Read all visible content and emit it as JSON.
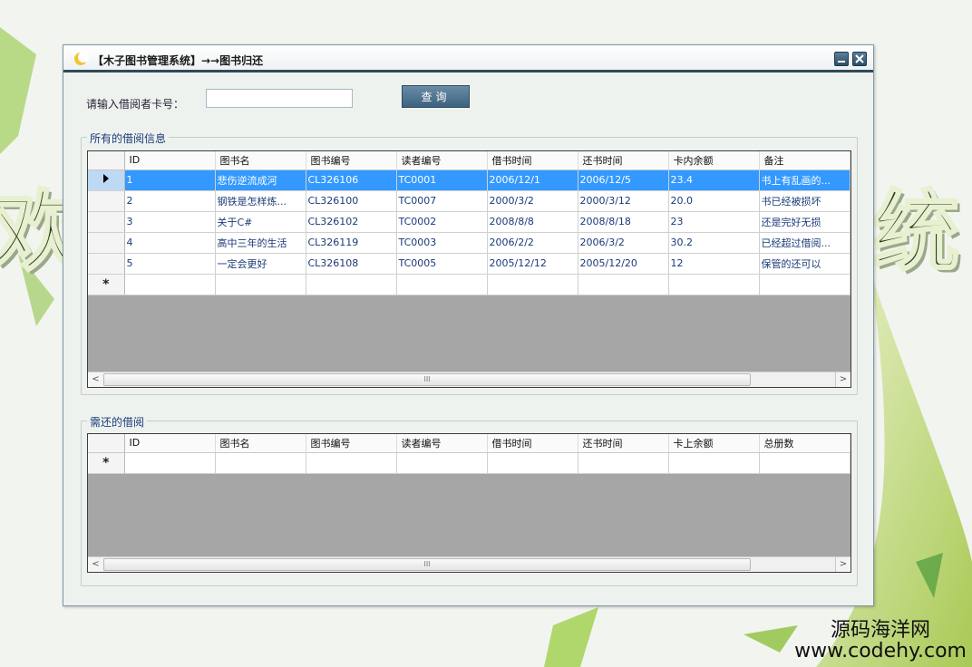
{
  "window": {
    "title": "【木子图书管理系统】→→图书归还"
  },
  "search": {
    "label": "请输入借阅者卡号：",
    "value": "",
    "button_label": "查询"
  },
  "borrow_group": {
    "title": "所有的借阅信息",
    "columns": [
      "ID",
      "图书名",
      "图书编号",
      "读者编号",
      "借书时间",
      "还书时间",
      "卡内余额",
      "备注"
    ],
    "rows": [
      [
        "1",
        "悲伤逆流成河",
        "CL326106",
        "TC0001",
        "2006/12/1",
        "2006/12/5",
        "23.4",
        "书上有乱画的..."
      ],
      [
        "2",
        "钢铁是怎样炼...",
        "CL326100",
        "TC0007",
        "2000/3/2",
        "2000/3/12",
        "20.0",
        "书已经被损坏"
      ],
      [
        "3",
        "关于C#",
        "CL326102",
        "TC0002",
        "2008/8/8",
        "2008/8/18",
        "23",
        "还是完好无损"
      ],
      [
        "4",
        "高中三年的生活",
        "CL326119",
        "TC0003",
        "2006/2/2",
        "2006/3/2",
        "30.2",
        "已经超过借阅..."
      ],
      [
        "5",
        "一定会更好",
        "CL326108",
        "TC0005",
        "2005/12/12",
        "2005/12/20",
        "12",
        "保管的还可以"
      ]
    ]
  },
  "return_group": {
    "title": "需还的借阅",
    "columns": [
      "ID",
      "图书名",
      "图书编号",
      "读者编号",
      "借书时间",
      "还书时间",
      "卡上余额",
      "总册数"
    ]
  },
  "grid": {
    "new_row_marker": "*",
    "scroll_left": "<",
    "scroll_right": ">",
    "scroll_grip": "III"
  },
  "background": {
    "text_left": "欢",
    "text_right": "统"
  },
  "watermark": {
    "line1": "源码海洋网",
    "line2": "www.codehy.com"
  },
  "colors": {
    "selection": "#3399ff",
    "titlebar_border": "#2f4a5a",
    "group_title": "#1a3a78",
    "grid_empty": "#a6a6a6"
  }
}
